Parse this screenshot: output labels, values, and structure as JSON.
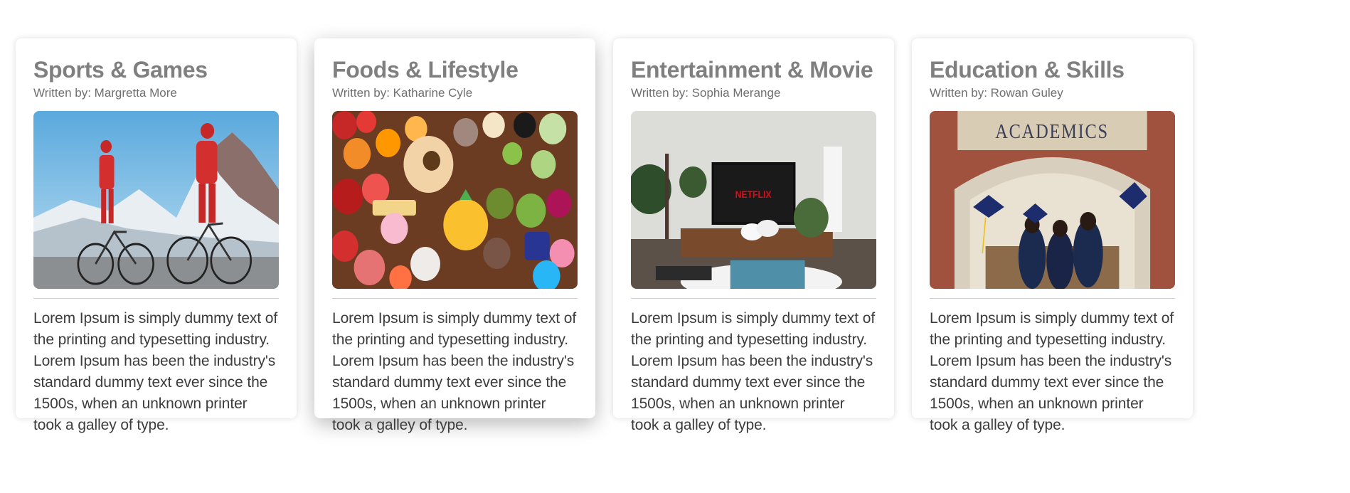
{
  "cards": [
    {
      "title": "Sports & Games",
      "author": "Written by: Margretta More",
      "image_icon": "cyclists-mountain-photo",
      "body": "Lorem Ipsum is simply dummy text of the printing and typesetting industry. Lorem Ipsum has been the industry's standard dummy text ever since the 1500s, when an unknown printer took a galley of type."
    },
    {
      "title": "Foods & Lifestyle",
      "author": "Written by: Katharine Cyle",
      "image_icon": "food-spread-photo",
      "body": "Lorem Ipsum is simply dummy text of the printing and typesetting industry. Lorem Ipsum has been the industry's standard dummy text ever since the 1500s, when an unknown printer took a galley of type."
    },
    {
      "title": "Entertainment & Movie",
      "author": "Written by: Sophia Merange",
      "image_icon": "tv-living-room-photo",
      "image_text": "NETFLIX",
      "body": "Lorem Ipsum is simply dummy text of the printing and typesetting industry. Lorem Ipsum has been the industry's standard dummy text ever since the 1500s, when an unknown printer took a galley of type."
    },
    {
      "title": "Education & Skills",
      "author": "Written by: Rowan Guley",
      "image_icon": "graduation-academics-photo",
      "image_text": "ACADEMICS",
      "body": "Lorem Ipsum is simply dummy text of the printing and typesetting industry. Lorem Ipsum has been the industry's standard dummy text ever since the 1500s, when an unknown printer took a galley of type."
    }
  ],
  "colors": {
    "title": "#7f7f7f",
    "author": "#6f6f6f",
    "body": "#3c3c3c",
    "divider": "#cfcfcf"
  }
}
